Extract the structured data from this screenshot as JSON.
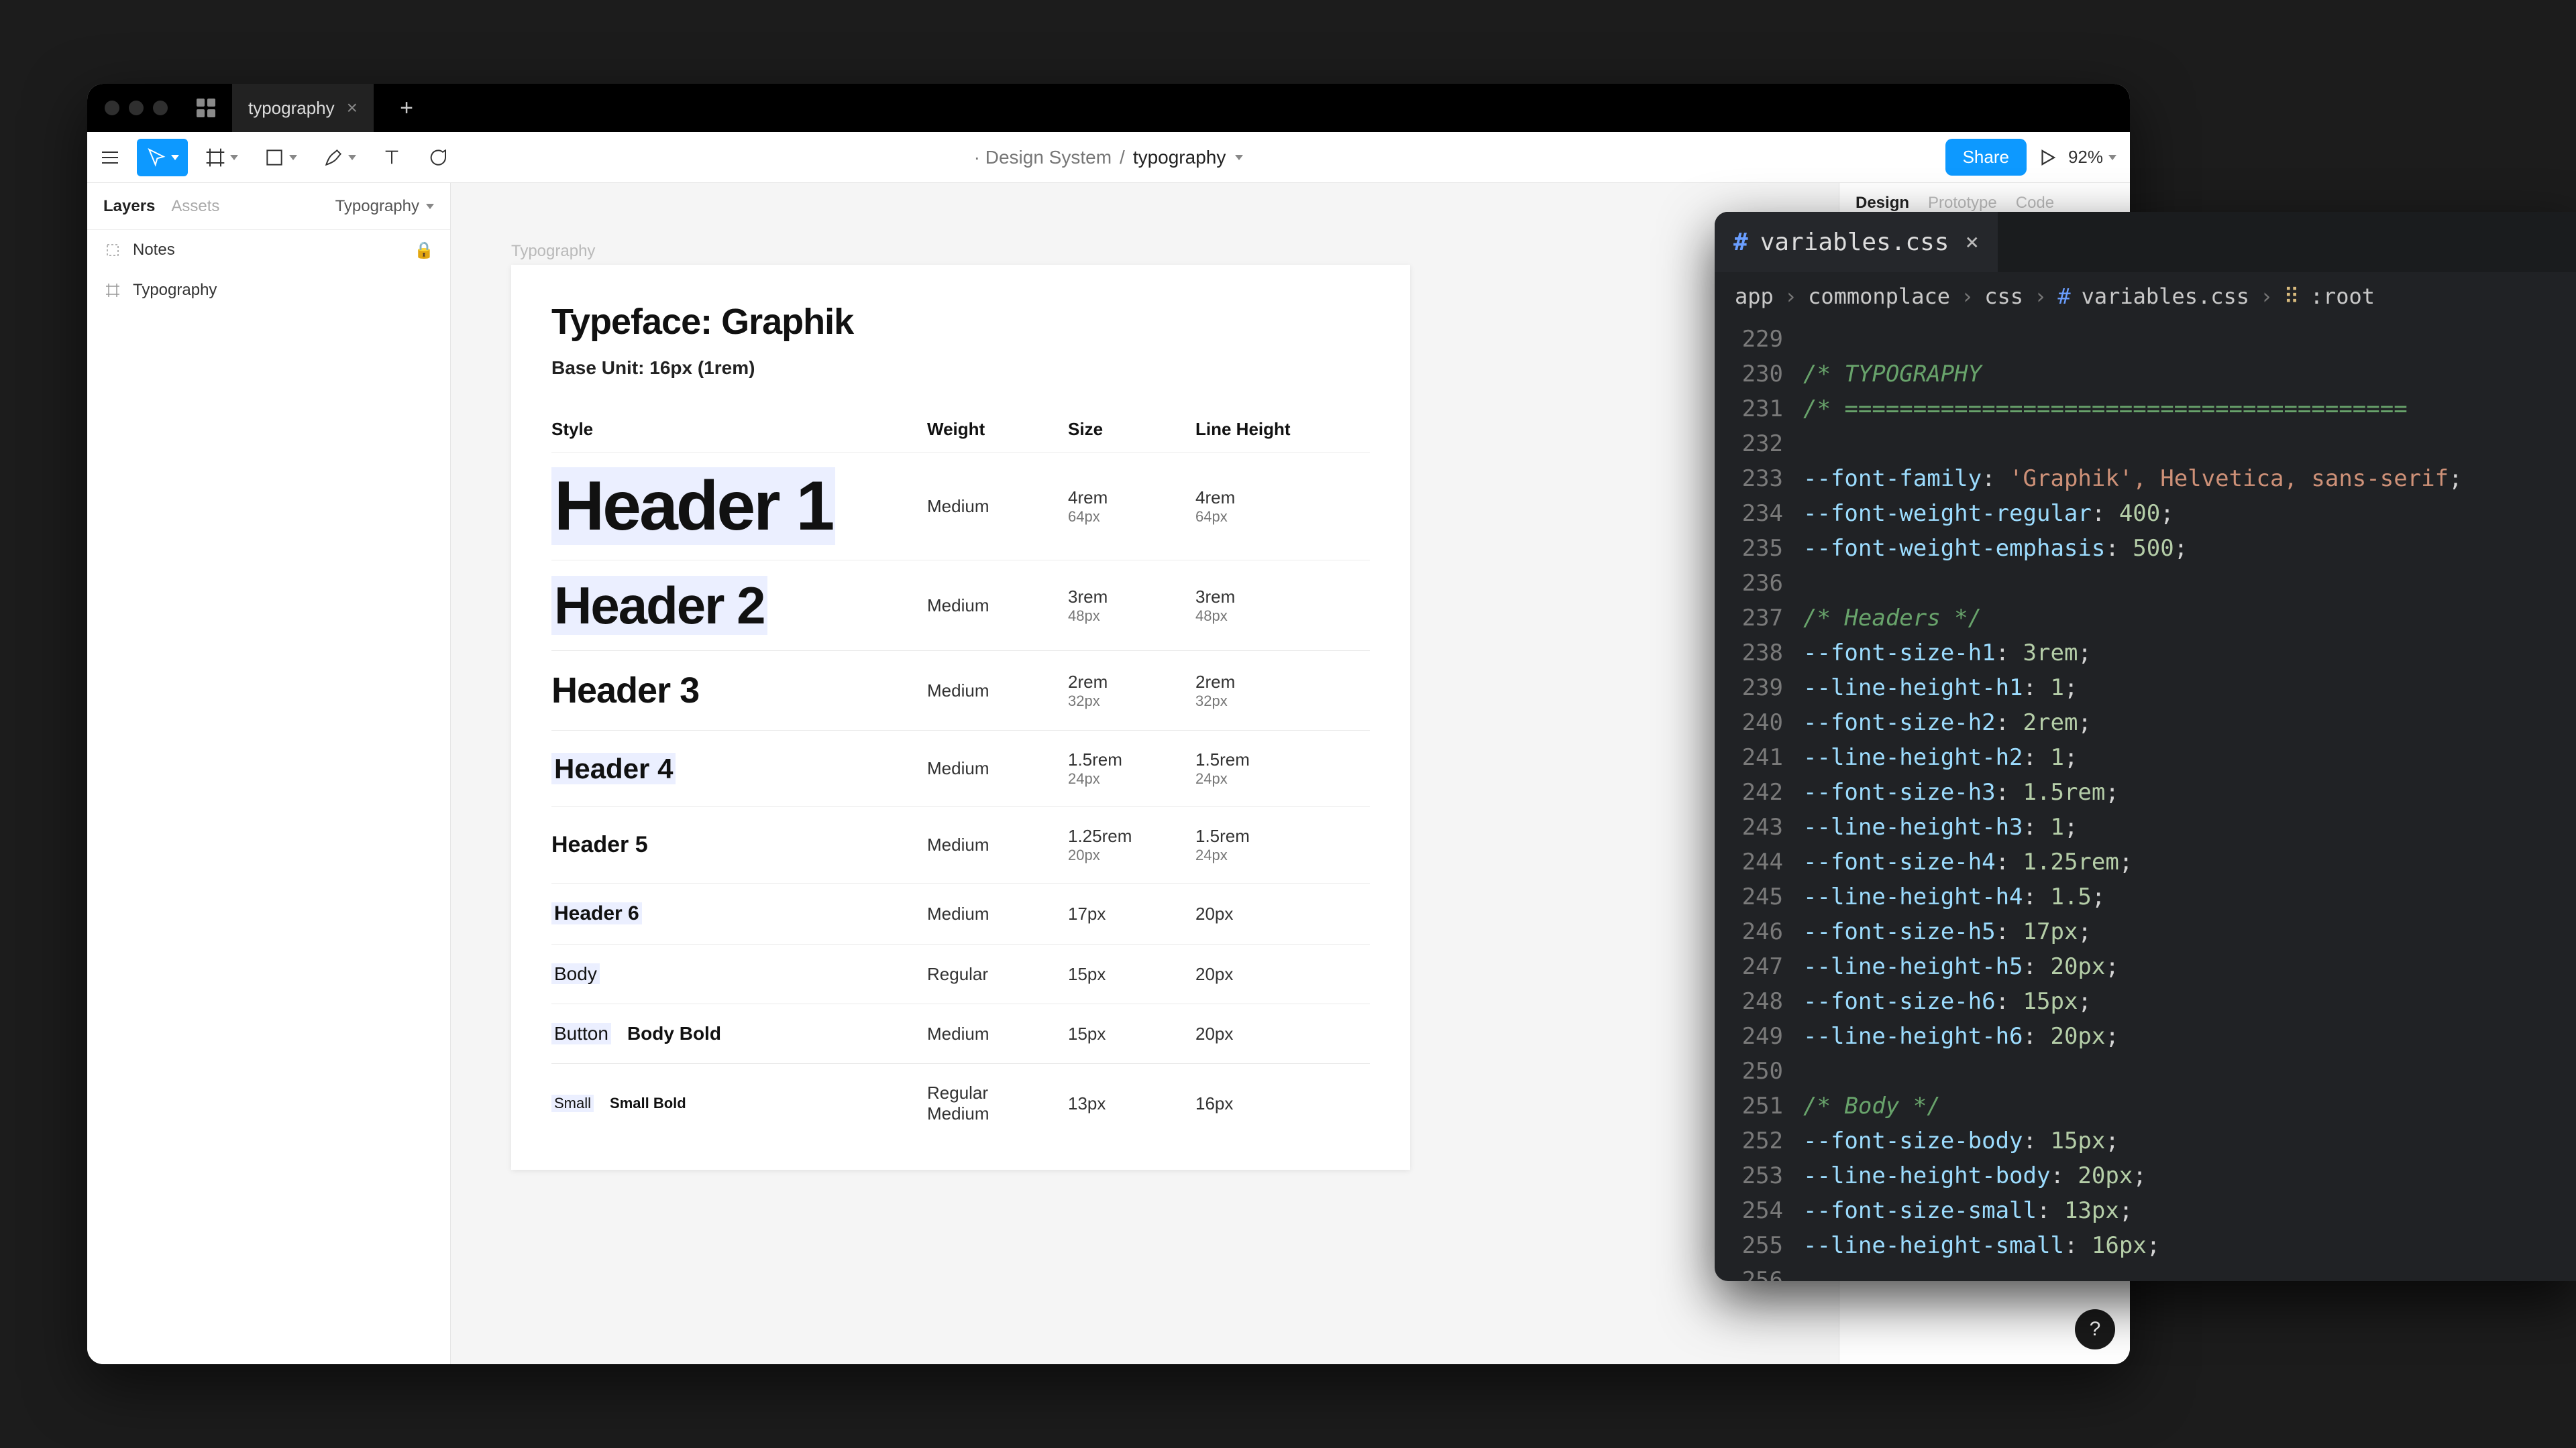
{
  "figma": {
    "doc_tab": "typography",
    "new_tab": "+",
    "breadcrumb": {
      "project": "· Design System",
      "sep": "/",
      "page": "typography"
    },
    "toolbar": {
      "share": "Share",
      "zoom": "92%"
    },
    "left_panel": {
      "tabs": {
        "layers": "Layers",
        "assets": "Assets"
      },
      "page_selector": "Typography",
      "layers": [
        {
          "name": "Notes",
          "locked": true
        },
        {
          "name": "Typography",
          "locked": false
        }
      ]
    },
    "right_panel": {
      "tabs": [
        "Design",
        "Prototype",
        "Code"
      ]
    },
    "canvas": {
      "frame_label": "Typography"
    },
    "artboard": {
      "title": "Typeface: Graphik",
      "subtitle": "Base Unit: 16px (1rem)",
      "columns": {
        "style": "Style",
        "weight": "Weight",
        "size": "Size",
        "lh": "Line Height"
      },
      "rows": [
        {
          "label": "Header 1",
          "cls": "style-h1",
          "hl": true,
          "weight": "Medium",
          "size": "4rem",
          "size_px": "64px",
          "lh": "4rem",
          "lh_px": "64px"
        },
        {
          "label": "Header 2",
          "cls": "style-h2",
          "hl": true,
          "weight": "Medium",
          "size": "3rem",
          "size_px": "48px",
          "lh": "3rem",
          "lh_px": "48px"
        },
        {
          "label": "Header 3",
          "cls": "style-h3",
          "hl": false,
          "weight": "Medium",
          "size": "2rem",
          "size_px": "32px",
          "lh": "2rem",
          "lh_px": "32px"
        },
        {
          "label": "Header 4",
          "cls": "style-h4",
          "hl": true,
          "weight": "Medium",
          "size": "1.5rem",
          "size_px": "24px",
          "lh": "1.5rem",
          "lh_px": "24px"
        },
        {
          "label": "Header 5",
          "cls": "style-h5",
          "hl": false,
          "weight": "Medium",
          "size": "1.25rem",
          "size_px": "20px",
          "lh": "1.5rem",
          "lh_px": "24px"
        },
        {
          "label": "Header 6",
          "cls": "style-h6",
          "hl": true,
          "weight": "Medium",
          "size": "17px",
          "size_px": "",
          "lh": "20px",
          "lh_px": ""
        },
        {
          "label": "Body",
          "cls": "style-body",
          "hl": true,
          "weight": "Regular",
          "size": "15px",
          "size_px": "",
          "lh": "20px",
          "lh_px": ""
        }
      ],
      "row_button": {
        "labels": [
          "Button",
          "Body Bold"
        ],
        "weight": "Medium",
        "size": "15px",
        "lh": "20px"
      },
      "row_small": {
        "labels": [
          "Small",
          "Small Bold"
        ],
        "weight": "Regular\nMedium",
        "size": "13px",
        "lh": "16px"
      }
    },
    "help": "?"
  },
  "editor": {
    "tab": {
      "hash": "#",
      "name": "variables.css"
    },
    "crumb": [
      "app",
      "commonplace",
      "css",
      "variables.css",
      ":root"
    ],
    "first_line": 229,
    "lines": [
      "",
      "/* TYPOGRAPHY",
      "/* =========================================",
      "",
      "--font-family: 'Graphik', Helvetica, sans-serif;",
      "--font-weight-regular: 400;",
      "--font-weight-emphasis: 500;",
      "",
      "/* Headers */",
      "--font-size-h1: 3rem;",
      "--line-height-h1: 1;",
      "--font-size-h2: 2rem;",
      "--line-height-h2: 1;",
      "--font-size-h3: 1.5rem;",
      "--line-height-h3: 1;",
      "--font-size-h4: 1.25rem;",
      "--line-height-h4: 1.5;",
      "--font-size-h5: 17px;",
      "--line-height-h5: 20px;",
      "--font-size-h6: 15px;",
      "--line-height-h6: 20px;",
      "",
      "/* Body */",
      "--font-size-body: 15px;",
      "--line-height-body: 20px;",
      "--font-size-small: 13px;",
      "--line-height-small: 16px;",
      ""
    ]
  }
}
